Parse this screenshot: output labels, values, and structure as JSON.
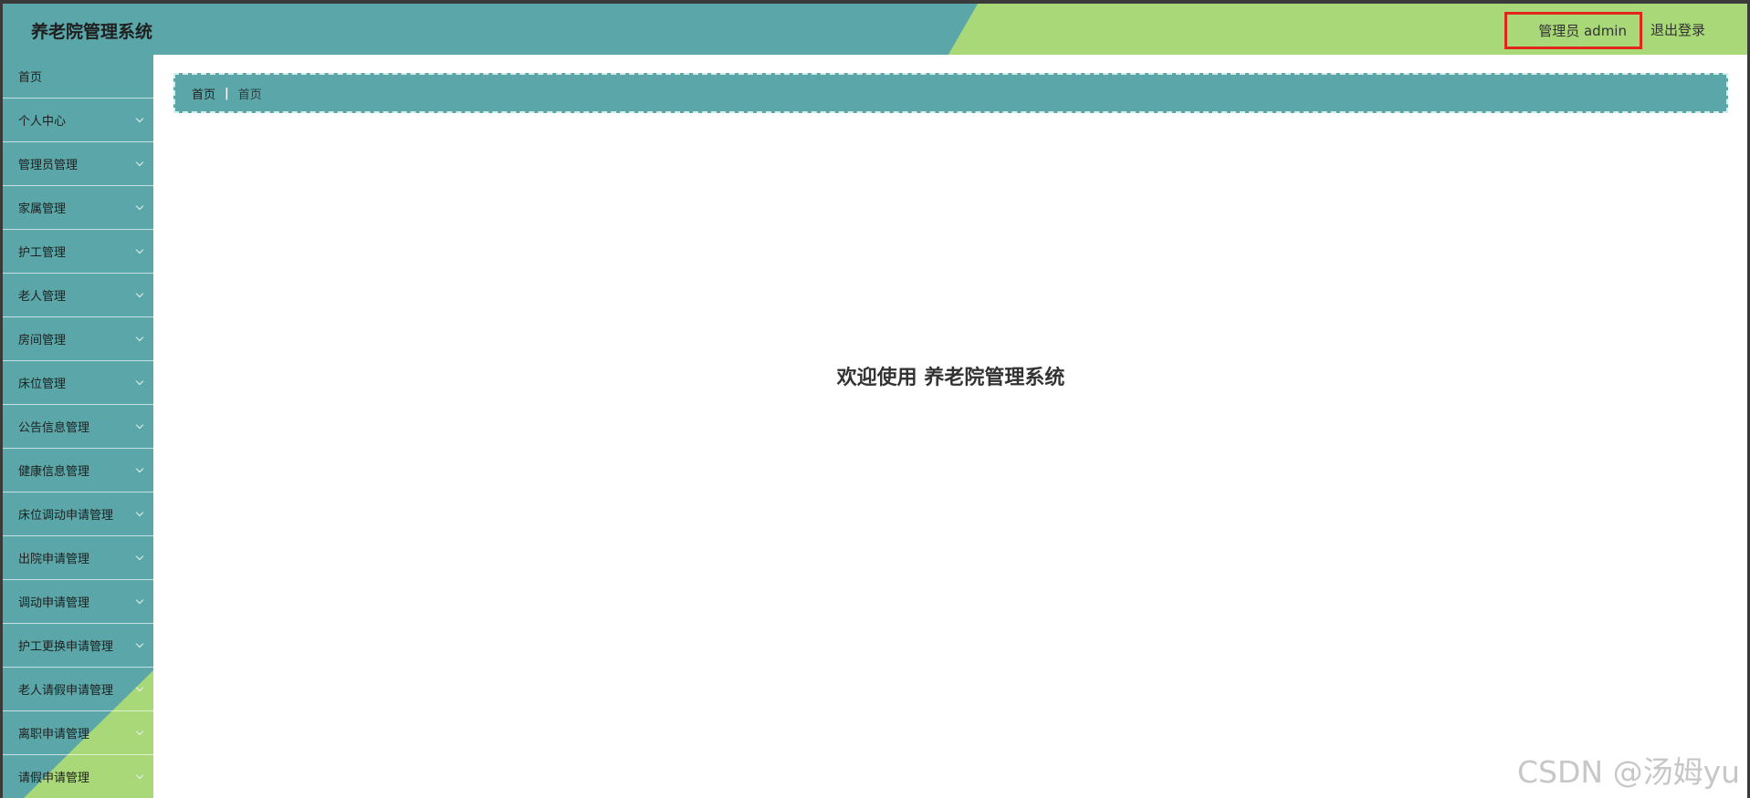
{
  "header": {
    "title": "养老院管理系统",
    "user_label": "管理员 admin",
    "logout_label": "退出登录"
  },
  "sidebar": {
    "items": [
      {
        "label": "首页",
        "has_submenu": false
      },
      {
        "label": "个人中心",
        "has_submenu": true
      },
      {
        "label": "管理员管理",
        "has_submenu": true
      },
      {
        "label": "家属管理",
        "has_submenu": true
      },
      {
        "label": "护工管理",
        "has_submenu": true
      },
      {
        "label": "老人管理",
        "has_submenu": true
      },
      {
        "label": "房间管理",
        "has_submenu": true
      },
      {
        "label": "床位管理",
        "has_submenu": true
      },
      {
        "label": "公告信息管理",
        "has_submenu": true
      },
      {
        "label": "健康信息管理",
        "has_submenu": true
      },
      {
        "label": "床位调动申请管理",
        "has_submenu": true
      },
      {
        "label": "出院申请管理",
        "has_submenu": true
      },
      {
        "label": "调动申请管理",
        "has_submenu": true
      },
      {
        "label": "护工更换申请管理",
        "has_submenu": true
      },
      {
        "label": "老人请假申请管理",
        "has_submenu": true
      },
      {
        "label": "离职申请管理",
        "has_submenu": true
      },
      {
        "label": "请假申请管理",
        "has_submenu": true
      }
    ]
  },
  "breadcrumb": {
    "home": "首页",
    "separator": "|",
    "current": "首页"
  },
  "main": {
    "welcome": "欢迎使用 养老院管理系统"
  },
  "watermark": "CSDN @汤姆yu",
  "colors": {
    "teal": "#5aa6a8",
    "green": "#a8d877",
    "highlight": "#e0261b"
  }
}
